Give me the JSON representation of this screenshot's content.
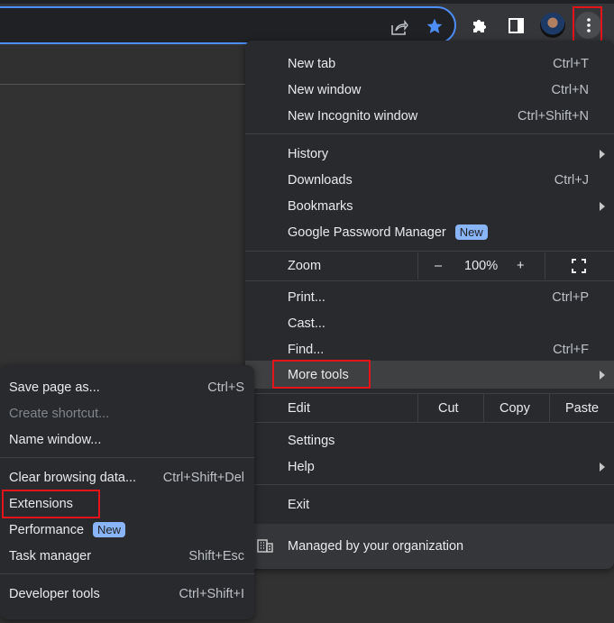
{
  "toolbar": {
    "icons": [
      "share-icon",
      "star-icon",
      "extensions-icon",
      "side-panel-icon",
      "avatar",
      "menu-icon"
    ]
  },
  "menu": {
    "group1": [
      {
        "label": "New tab",
        "shortcut": "Ctrl+T"
      },
      {
        "label": "New window",
        "shortcut": "Ctrl+N"
      },
      {
        "label": "New Incognito window",
        "shortcut": "Ctrl+Shift+N"
      }
    ],
    "group2": [
      {
        "label": "History"
      },
      {
        "label": "Downloads",
        "shortcut": "Ctrl+J"
      },
      {
        "label": "Bookmarks"
      },
      {
        "label": "Google Password Manager",
        "badge": "New"
      }
    ],
    "zoom": {
      "label": "Zoom",
      "minus": "–",
      "value": "100%",
      "plus": "+"
    },
    "group3": [
      {
        "label": "Print...",
        "shortcut": "Ctrl+P"
      },
      {
        "label": "Cast..."
      },
      {
        "label": "Find...",
        "shortcut": "Ctrl+F"
      },
      {
        "label": "More tools"
      }
    ],
    "edit": {
      "label": "Edit",
      "cut": "Cut",
      "copy": "Copy",
      "paste": "Paste"
    },
    "group4": [
      {
        "label": "Settings"
      },
      {
        "label": "Help"
      }
    ],
    "exit": "Exit",
    "managed": "Managed by your organization"
  },
  "submenu": {
    "group1": [
      {
        "label": "Save page as...",
        "shortcut": "Ctrl+S"
      },
      {
        "label": "Create shortcut..."
      },
      {
        "label": "Name window..."
      }
    ],
    "group2": [
      {
        "label": "Clear browsing data...",
        "shortcut": "Ctrl+Shift+Del"
      },
      {
        "label": "Extensions"
      },
      {
        "label": "Performance",
        "badge": "New"
      },
      {
        "label": "Task manager",
        "shortcut": "Shift+Esc"
      }
    ],
    "devtools": {
      "label": "Developer tools",
      "shortcut": "Ctrl+Shift+I"
    }
  }
}
